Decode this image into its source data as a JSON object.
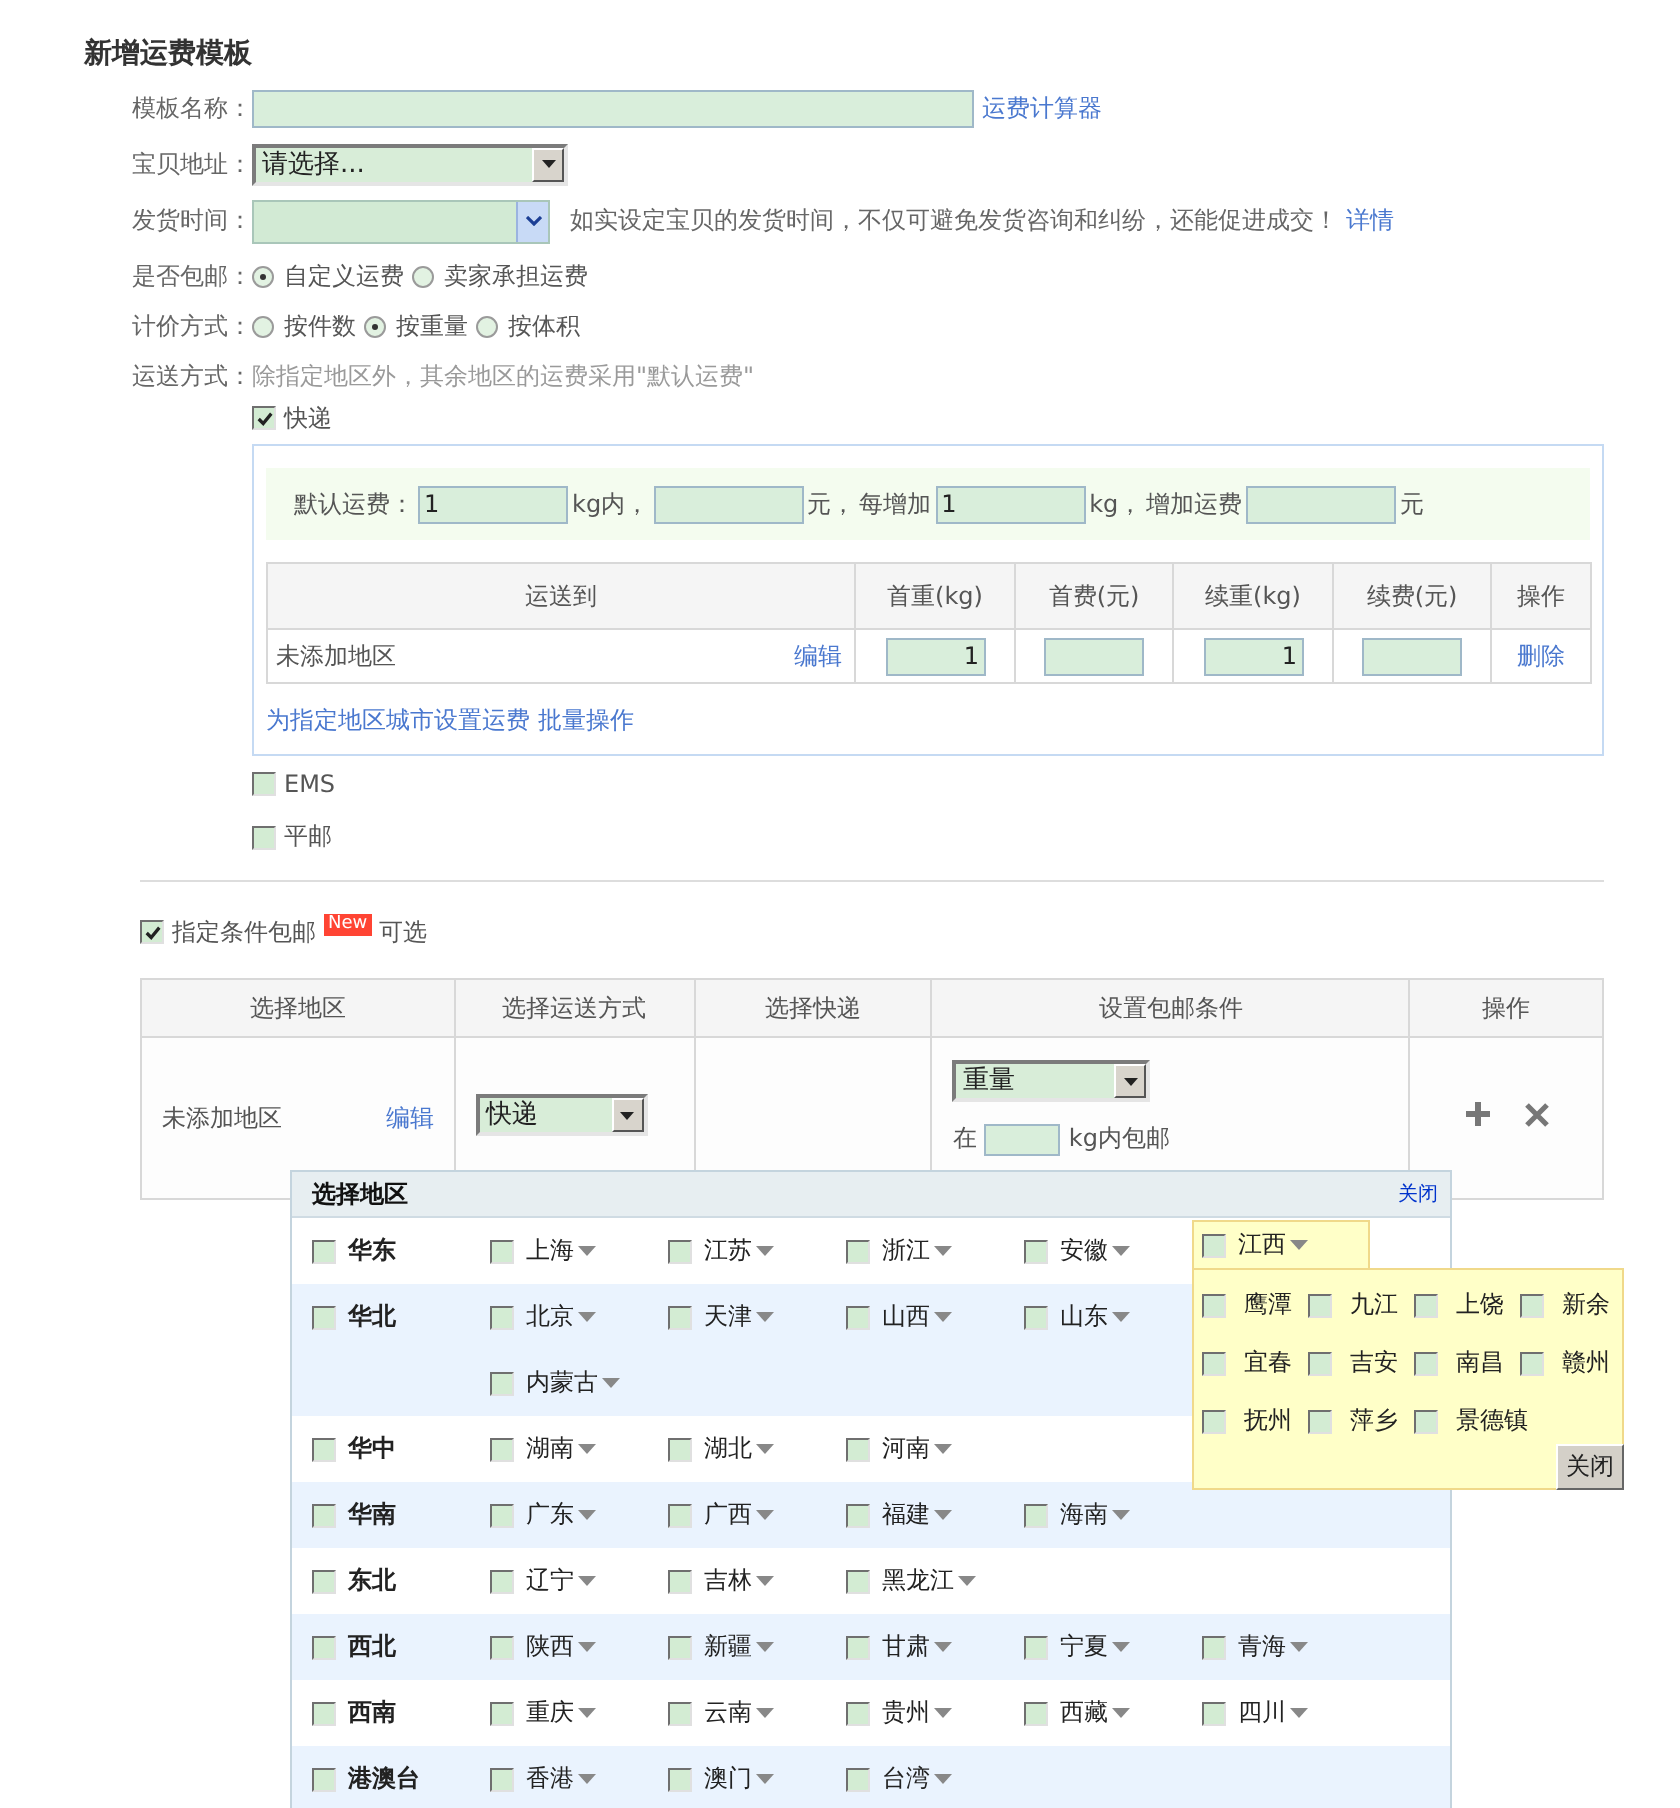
{
  "title": "新增运费模板",
  "fields": [
    {
      "kind": "text",
      "label": "模板名称：",
      "link": "运费计算器"
    },
    {
      "kind": "select",
      "label": "宝贝地址：",
      "value": "请选择..."
    },
    {
      "kind": "dropdown",
      "label": "发货时间：",
      "hint": "如实设定宝贝的发货时间，不仅可避免发货咨询和纠纷，还能促进成交！",
      "link": "详情"
    },
    {
      "kind": "radio",
      "label": "是否包邮：",
      "options": [
        {
          "label": "自定义运费",
          "selected": true
        },
        {
          "label": "卖家承担运费",
          "selected": false
        }
      ]
    },
    {
      "kind": "radio",
      "label": "计价方式：",
      "options": [
        {
          "label": "按件数",
          "selected": false
        },
        {
          "label": "按重量",
          "selected": true
        },
        {
          "label": "按体积",
          "selected": false
        }
      ]
    }
  ],
  "shipping": {
    "label": "运送方式：",
    "note": "除指定地区外，其余地区的运费采用\"默认运费\"",
    "methods": [
      {
        "label": "快递",
        "checked": true,
        "panel": {
          "default_fee": [
            {
              "kind": "text",
              "text": "默认运费："
            },
            {
              "kind": "input",
              "value": "1"
            },
            {
              "kind": "text",
              "text": "kg内，"
            },
            {
              "kind": "input"
            },
            {
              "kind": "text",
              "text": "元，"
            },
            {
              "kind": "text",
              "text": "每增加"
            },
            {
              "kind": "input",
              "value": "1"
            },
            {
              "kind": "text",
              "text": "kg，"
            },
            {
              "kind": "text",
              "text": "增加运费"
            },
            {
              "kind": "input"
            },
            {
              "kind": "text",
              "text": "元"
            }
          ],
          "columns": [
            "运送到",
            "首重(kg)",
            "首费(元)",
            "续重(kg)",
            "续费(元)",
            "操作"
          ],
          "rows": [
            {
              "region": "未添加地区",
              "edit": "编辑",
              "first_weight": "1",
              "extra_weight": "1",
              "action": "删除"
            }
          ],
          "links": [
            "为指定地区城市设置运费",
            "批量操作"
          ]
        }
      },
      {
        "label": "EMS",
        "checked": false
      },
      {
        "label": "平邮",
        "checked": false
      }
    ]
  },
  "free_shipping": {
    "checked": true,
    "label": "指定条件包邮",
    "badge": "New",
    "note": "可选",
    "columns": [
      "选择地区",
      "选择运送方式",
      "选择快递",
      "设置包邮条件",
      "操作"
    ],
    "rows": [
      {
        "region": "未添加地区",
        "edit": "编辑",
        "method": "快递",
        "condition": "重量",
        "prefix": "在",
        "suffix": "kg内包邮"
      }
    ]
  },
  "picker": {
    "title": "选择地区",
    "close": "关闭",
    "close_button": "关闭",
    "groups": [
      {
        "name": "华东",
        "checked": false,
        "lines": [
          [
            {
              "name": "上海",
              "checked": false,
              "expanded": false
            },
            {
              "name": "江苏",
              "checked": false,
              "expanded": false
            },
            {
              "name": "浙江",
              "checked": false,
              "expanded": false
            },
            {
              "name": "安徽",
              "checked": false,
              "expanded": false
            },
            {
              "name": "江西",
              "checked": false,
              "expanded": true,
              "cities": [
                {
                  "name": "鹰潭",
                  "checked": false
                },
                {
                  "name": "九江",
                  "checked": false
                },
                {
                  "name": "上饶",
                  "checked": false
                },
                {
                  "name": "新余",
                  "checked": false
                },
                {
                  "name": "宜春",
                  "checked": false
                },
                {
                  "name": "吉安",
                  "checked": false
                },
                {
                  "name": "南昌",
                  "checked": false
                },
                {
                  "name": "赣州",
                  "checked": false
                },
                {
                  "name": "抚州",
                  "checked": false
                },
                {
                  "name": "萍乡",
                  "checked": false
                },
                {
                  "name": "景德镇",
                  "checked": false
                }
              ]
            }
          ]
        ]
      },
      {
        "name": "华北",
        "checked": false,
        "lines": [
          [
            {
              "name": "北京",
              "checked": false,
              "expanded": false
            },
            {
              "name": "天津",
              "checked": false,
              "expanded": false
            },
            {
              "name": "山西",
              "checked": false,
              "expanded": false
            },
            {
              "name": "山东",
              "checked": false,
              "expanded": false
            }
          ],
          [
            {
              "name": "内蒙古",
              "checked": false,
              "expanded": false
            }
          ]
        ]
      },
      {
        "name": "华中",
        "checked": false,
        "lines": [
          [
            {
              "name": "湖南",
              "checked": false,
              "expanded": false
            },
            {
              "name": "湖北",
              "checked": false,
              "expanded": false
            },
            {
              "name": "河南",
              "checked": false,
              "expanded": false
            }
          ]
        ]
      },
      {
        "name": "华南",
        "checked": false,
        "lines": [
          [
            {
              "name": "广东",
              "checked": false,
              "expanded": false
            },
            {
              "name": "广西",
              "checked": false,
              "expanded": false
            },
            {
              "name": "福建",
              "checked": false,
              "expanded": false
            },
            {
              "name": "海南",
              "checked": false,
              "expanded": false
            }
          ]
        ]
      },
      {
        "name": "东北",
        "checked": false,
        "lines": [
          [
            {
              "name": "辽宁",
              "checked": false,
              "expanded": false
            },
            {
              "name": "吉林",
              "checked": false,
              "expanded": false
            },
            {
              "name": "黑龙江",
              "checked": false,
              "expanded": false
            }
          ]
        ]
      },
      {
        "name": "西北",
        "checked": false,
        "lines": [
          [
            {
              "name": "陕西",
              "checked": false,
              "expanded": false
            },
            {
              "name": "新疆",
              "checked": false,
              "expanded": false
            },
            {
              "name": "甘肃",
              "checked": false,
              "expanded": false
            },
            {
              "name": "宁夏",
              "checked": false,
              "expanded": false
            },
            {
              "name": "青海",
              "checked": false,
              "expanded": false
            }
          ]
        ]
      },
      {
        "name": "西南",
        "checked": false,
        "lines": [
          [
            {
              "name": "重庆",
              "checked": false,
              "expanded": false
            },
            {
              "name": "云南",
              "checked": false,
              "expanded": false
            },
            {
              "name": "贵州",
              "checked": false,
              "expanded": false
            },
            {
              "name": "西藏",
              "checked": false,
              "expanded": false
            },
            {
              "name": "四川",
              "checked": false,
              "expanded": false
            }
          ]
        ]
      },
      {
        "name": "港澳台",
        "checked": false,
        "lines": [
          [
            {
              "name": "香港",
              "checked": false,
              "expanded": false
            },
            {
              "name": "澳门",
              "checked": false,
              "expanded": false
            },
            {
              "name": "台湾",
              "checked": false,
              "expanded": false
            }
          ]
        ]
      }
    ]
  }
}
